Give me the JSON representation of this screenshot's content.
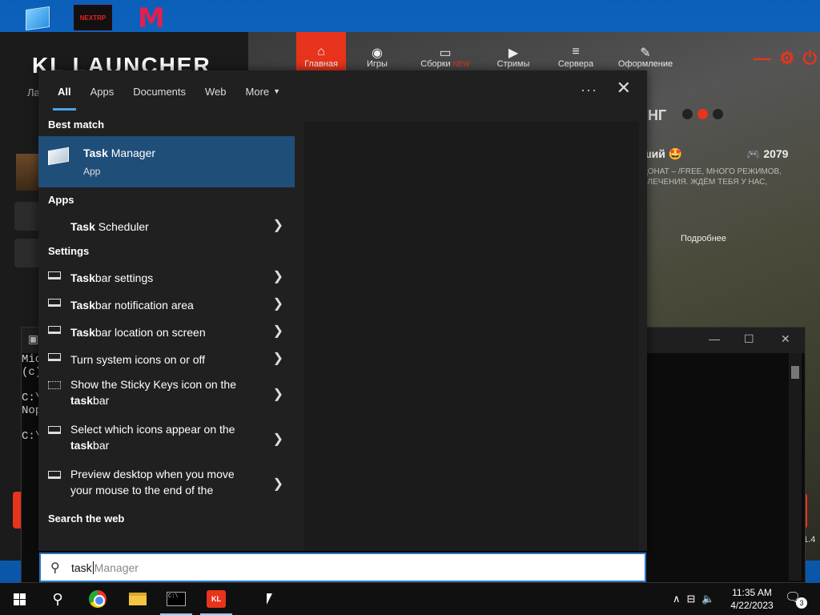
{
  "desktop": {
    "icons": [
      {
        "name": "monitor-icon"
      },
      {
        "name": "nextrp-icon",
        "text": "NEXTRP"
      },
      {
        "name": "m-app-icon",
        "text": "M"
      }
    ]
  },
  "launcher": {
    "brand": "KL LAUNCHER",
    "sub": "Ла",
    "nav": [
      {
        "label": "Главная",
        "icon": "⌂"
      },
      {
        "label": "Игры",
        "icon": "◉"
      },
      {
        "label": "Сборки",
        "badge": "NEW",
        "icon": "▭"
      },
      {
        "label": "Стримы",
        "icon": "▶"
      },
      {
        "label": "Сервера",
        "icon": "≡"
      },
      {
        "label": "Оформление",
        "icon": "✎"
      }
    ],
    "ming": "ИНГ",
    "server_title": "ший 🤩",
    "players": "2079",
    "desc": "ДОНАТ – /FREE, МНОГО РЕЖИМОВ, ВЛЕЧЕНИЯ. ЖДЁМ ТЕБЯ У НАС,",
    "more": "Подробнее",
    "version": ".1.4"
  },
  "cmd": {
    "lines": [
      "Mic",
      "(c)",
      "",
      "C:\\",
      "Nop",
      "",
      "C:\\"
    ]
  },
  "search": {
    "tabs": [
      "All",
      "Apps",
      "Documents",
      "Web",
      "More"
    ],
    "active_tab": "All",
    "sections": {
      "best_match": "Best match",
      "apps": "Apps",
      "settings": "Settings",
      "web": "Search the web"
    },
    "best_match": {
      "name_bold": "Task",
      "name_rest": " Manager",
      "kind": "App"
    },
    "apps": [
      {
        "bold": "Task",
        "rest": " Scheduler"
      }
    ],
    "settings": [
      {
        "bold": "Task",
        "rest": "bar settings"
      },
      {
        "bold": "Task",
        "rest": "bar notification area"
      },
      {
        "bold": "Task",
        "rest": "bar location on screen"
      },
      {
        "bold": "",
        "rest": "Turn system icons on or off"
      },
      {
        "pre": "Show the Sticky Keys icon on the ",
        "bold": "task",
        "rest": "bar"
      },
      {
        "pre": "Select which icons appear on the ",
        "bold": "task",
        "rest": "bar"
      },
      {
        "pre": "Preview desktop when you move your mouse to the end of the",
        "bold": "",
        "rest": ""
      }
    ],
    "query": "task",
    "suggestion": "Manager"
  },
  "taskbar": {
    "time": "11:35 AM",
    "date": "4/22/2023",
    "notifications": "3"
  },
  "colors": {
    "accent": "#4aa3f0",
    "selected": "#1f4e79",
    "launcher_red": "#e8341c"
  }
}
